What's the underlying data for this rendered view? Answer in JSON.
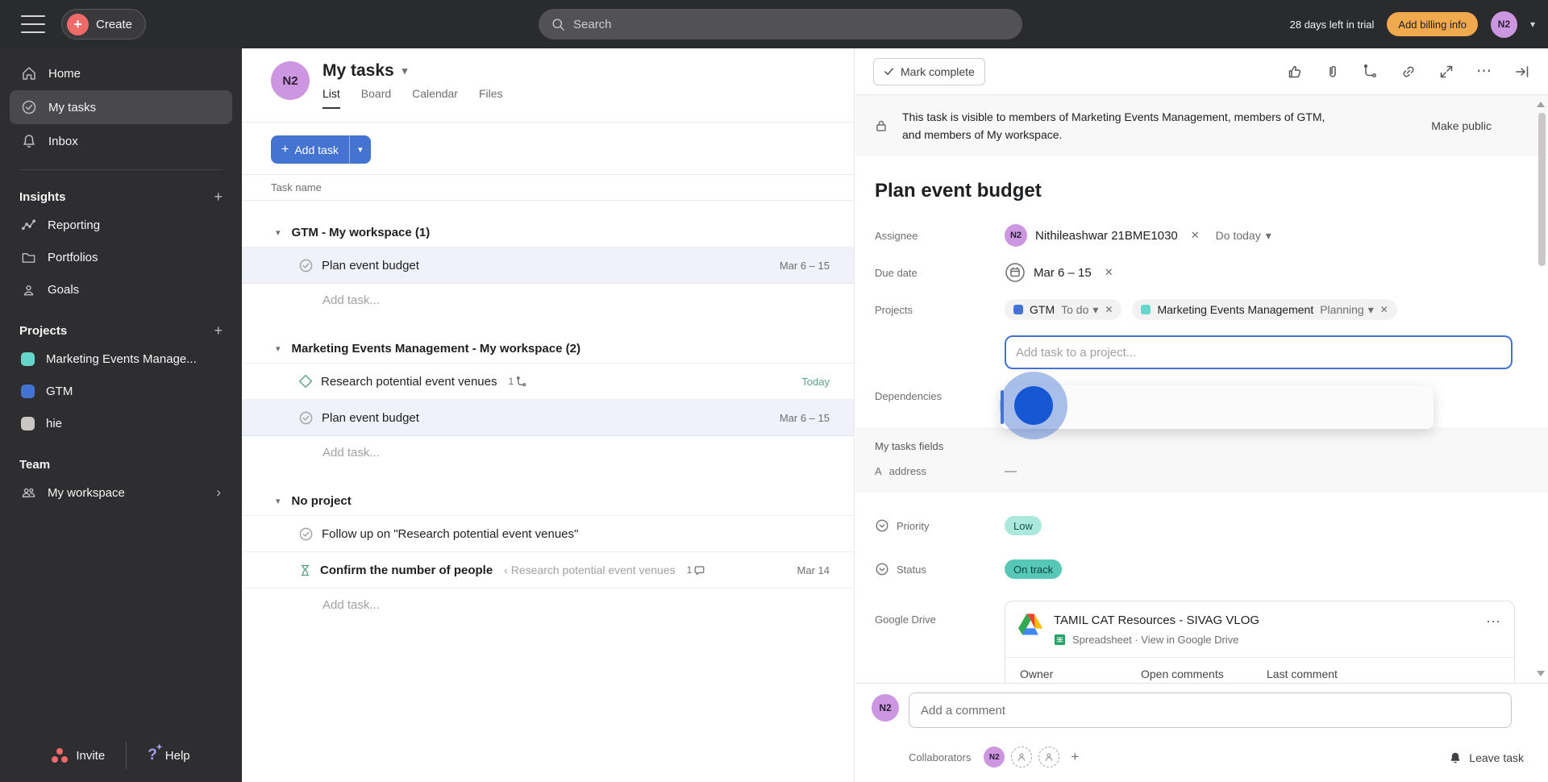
{
  "icons": {
    "plus": "+",
    "close": "✕",
    "more": "⋯",
    "chevron_down": "▾",
    "chevron_right": "›",
    "dash": "—",
    "address_glyph": "A"
  },
  "colors": {
    "accent_blue": "#4573d2",
    "coral": "#f06a6a",
    "amber": "#f1a94e",
    "avatar_purple": "#cd96e0",
    "teal": "#66d5cc",
    "project_gray": "#c9c6c6",
    "green": "#5da283",
    "low_bg": "#abe9dc",
    "ontrack_bg": "#57c8b8"
  },
  "topbar": {
    "create": "Create",
    "search_placeholder": "Search",
    "trial": "28 days left in trial",
    "billing": "Add billing info",
    "avatar": "N2"
  },
  "sidebar": {
    "nav": [
      {
        "label": "Home"
      },
      {
        "label": "My tasks"
      },
      {
        "label": "Inbox"
      }
    ],
    "insights_title": "Insights",
    "insights": [
      {
        "label": "Reporting"
      },
      {
        "label": "Portfolios"
      },
      {
        "label": "Goals"
      }
    ],
    "projects_title": "Projects",
    "projects": [
      {
        "label": "Marketing Events Manage..."
      },
      {
        "label": "GTM"
      },
      {
        "label": "hie"
      }
    ],
    "team_title": "Team",
    "team": [
      {
        "label": "My workspace"
      }
    ],
    "invite": "Invite",
    "help": "Help"
  },
  "main": {
    "avatar": "N2",
    "title": "My tasks",
    "tabs": [
      {
        "label": "List"
      },
      {
        "label": "Board"
      },
      {
        "label": "Calendar"
      },
      {
        "label": "Files"
      }
    ],
    "add_task": "Add task",
    "column_header": "Task name",
    "sections": [
      {
        "title": "GTM - My workspace (1)",
        "tasks": [
          {
            "name": "Plan event budget",
            "date": "Mar 6 – 15"
          }
        ],
        "add_task": "Add task..."
      },
      {
        "title": "Marketing Events Management - My workspace (2)",
        "tasks": [
          {
            "name": "Research potential event venues",
            "subtasks": "1",
            "date": "Today"
          },
          {
            "name": "Plan event budget",
            "date": "Mar 6 – 15"
          }
        ],
        "add_task": "Add task..."
      },
      {
        "title": "No project",
        "tasks": [
          {
            "name": "Follow up on \"Research potential event venues\""
          },
          {
            "name": "Confirm the number of people",
            "parent": "‹ Research potential event venues",
            "comments": "1",
            "date": "Mar 14"
          }
        ],
        "add_task": "Add task..."
      }
    ]
  },
  "detail": {
    "mark_complete": "Mark complete",
    "banner": {
      "text": "This task is visible to members of Marketing Events Management, members of GTM, and members of My workspace.",
      "action": "Make public"
    },
    "title": "Plan event budget",
    "assignee": {
      "label": "Assignee",
      "avatar": "N2",
      "name": "Nithileashwar 21BME1030",
      "schedule": "Do today"
    },
    "due": {
      "label": "Due date",
      "value": "Mar 6 – 15"
    },
    "projects": {
      "label": "Projects",
      "chips": [
        {
          "name": "GTM",
          "status": "To do"
        },
        {
          "name": "Marketing Events Management",
          "status": "Planning"
        }
      ],
      "placeholder": "Add task to a project..."
    },
    "dependencies_label": "Dependencies",
    "fields_title": "My tasks fields",
    "address": {
      "label": "address",
      "value": "—"
    },
    "priority": {
      "label": "Priority",
      "value": "Low"
    },
    "status": {
      "label": "Status",
      "value": "On track"
    },
    "gdrive": {
      "label": "Google Drive",
      "file_title": "TAMIL CAT Resources - SIVAG VLOG",
      "file_meta": "Spreadsheet · View in Google Drive",
      "columns": [
        {
          "label": "Owner"
        },
        {
          "label": "Open comments"
        },
        {
          "label": "Last comment"
        }
      ]
    },
    "comment": {
      "avatar": "N2",
      "placeholder": "Add a comment",
      "collaborators_label": "Collaborators",
      "leave": "Leave task"
    }
  }
}
